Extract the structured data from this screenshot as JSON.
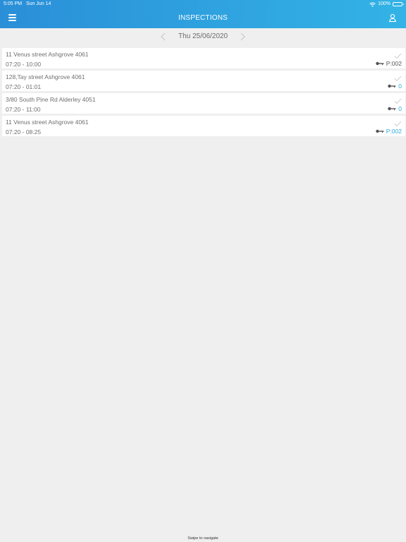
{
  "status_bar": {
    "time": "5:05 PM",
    "date": "Sun Jun 14",
    "battery": "100%"
  },
  "header": {
    "title": "INSPECTIONS",
    "menu_icon": "menu-icon",
    "user_icon": "user-location-icon"
  },
  "date_nav": {
    "label": "Thu 25/06/2020"
  },
  "inspections": [
    {
      "address": "11 Venus street Ashgrove 4061",
      "time": "07:20 - 10:00",
      "key_code": "P:002",
      "key_color": "dark"
    },
    {
      "address": "128,Tay street Ashgrove 4061",
      "time": "07:20 - 01:01",
      "key_code": "0",
      "key_color": "blue"
    },
    {
      "address": "3/80 South Pine Rd Alderley 4051",
      "time": "07:20 - 11:00",
      "key_code": "0",
      "key_color": "blue"
    },
    {
      "address": "11 Venus street Ashgrove 4061",
      "time": "07:20 - 08:25",
      "key_code": "P:002",
      "key_color": "blue"
    }
  ],
  "footer": {
    "hint": "Swipe to navigate"
  },
  "colors": {
    "header_start": "#2a8fd8",
    "header_end": "#33b3e6",
    "accent_blue": "#2fa8e0",
    "background": "#efefef"
  }
}
